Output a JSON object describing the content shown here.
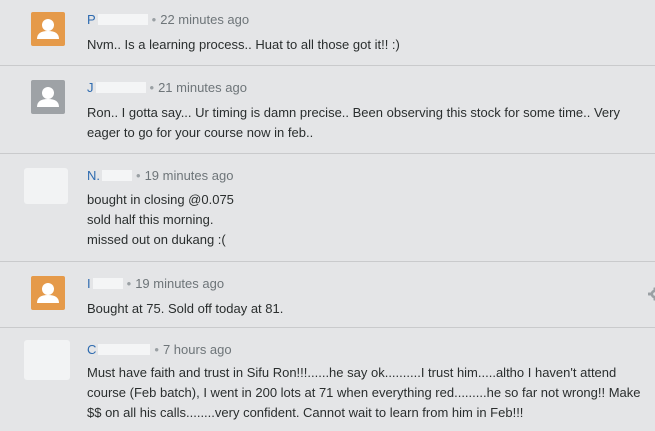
{
  "comments": [
    {
      "author": "P",
      "time": "22 minutes ago",
      "lines": [
        "Nvm.. Is a learning process.. Huat to all those got it!! :)"
      ]
    },
    {
      "author": "J",
      "time": "21 minutes ago",
      "lines": [
        "Ron.. I gotta say... Ur timing is damn precise.. Been observing this stock for some time.. Very",
        "eager to go for your course now in feb.."
      ]
    },
    {
      "author": "N.",
      "time": "19 minutes ago",
      "lines": [
        "bought in closing @0.075",
        "sold half this morning.",
        "missed out on dukang :("
      ]
    },
    {
      "author": "I",
      "time": "19 minutes ago",
      "lines": [
        "Bought at 75. Sold off today at 81."
      ]
    },
    {
      "author": "C",
      "time": "7 hours ago",
      "lines": [
        "Must have faith and trust in Sifu Ron!!!......he say ok..........I trust him.....altho I haven't attend",
        "course (Feb batch), I went in 200 lots at 71 when everything red.........he so far not wrong!! Make",
        "$$ on all his calls........very confident. Cannot wait to learn from him in Feb!!!"
      ]
    }
  ],
  "separator": "•",
  "icons": {
    "avatar_orange": "#e59a4a",
    "avatar_gray": "#9ea2a6",
    "settings": "gear-icon"
  }
}
